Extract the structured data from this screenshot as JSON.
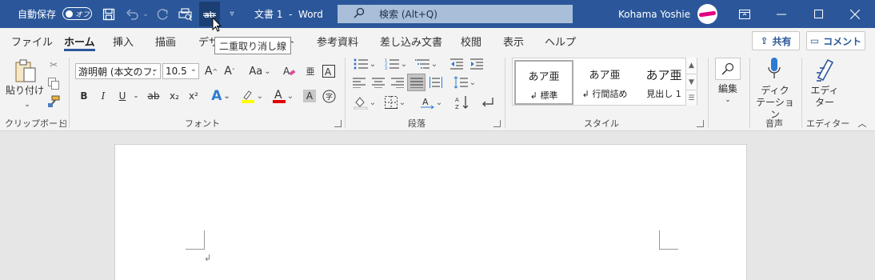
{
  "titlebar": {
    "autosave_label": "自動保存",
    "autosave_state": "オフ",
    "doc_title": "文書 1  -  Word",
    "search_placeholder": "検索 (Alt+Q)",
    "user_name": "Kohama Yoshie"
  },
  "tabs": [
    "ファイル",
    "ホーム",
    "挿入",
    "描画",
    "デザイン",
    "レイアウト",
    "参考資料",
    "差し込み文書",
    "校閲",
    "表示",
    "ヘルプ"
  ],
  "tabs_visible": {
    "file": "ファイル",
    "home": "ホーム",
    "insert": "挿入",
    "draw": "描画",
    "design_partial": "デザ",
    "layout_partial": "ウト",
    "references": "参考資料",
    "mailings": "差し込み文書",
    "review": "校閲",
    "view": "表示",
    "help": "ヘルプ"
  },
  "actions": {
    "share": "共有",
    "comment": "コメント"
  },
  "tooltip": "二重取り消し線",
  "clipboard": {
    "paste_label": "貼り付け",
    "group": "クリップボード"
  },
  "font": {
    "name": "游明朝 (本文のフ:",
    "size": "10.5",
    "group": "フォント",
    "bold": "B",
    "italic": "I",
    "underline": "U",
    "strike": "ab",
    "subscript": "x₂",
    "superscript": "x²",
    "grow": "A^",
    "shrink": "A˅",
    "case": "Aa",
    "effect": "A",
    "highlight_color": "#ffff00",
    "font_color": "#e00000"
  },
  "paragraph": {
    "group": "段落"
  },
  "styles": {
    "group": "スタイル",
    "items": [
      {
        "preview": "あア亜",
        "name": "↲ 標準"
      },
      {
        "preview": "あア亜",
        "name": "↲ 行間詰め"
      },
      {
        "preview": "あア亜",
        "name": "見出し 1"
      }
    ]
  },
  "editing": {
    "label": "編集"
  },
  "voice": {
    "label1": "ディク",
    "label2": "テーション",
    "group": "音声"
  },
  "editor": {
    "label1": "エディ",
    "label2": "ター",
    "group": "エディター"
  },
  "colors": {
    "titlebar": "#2b579a",
    "accent": "#2b579a"
  }
}
